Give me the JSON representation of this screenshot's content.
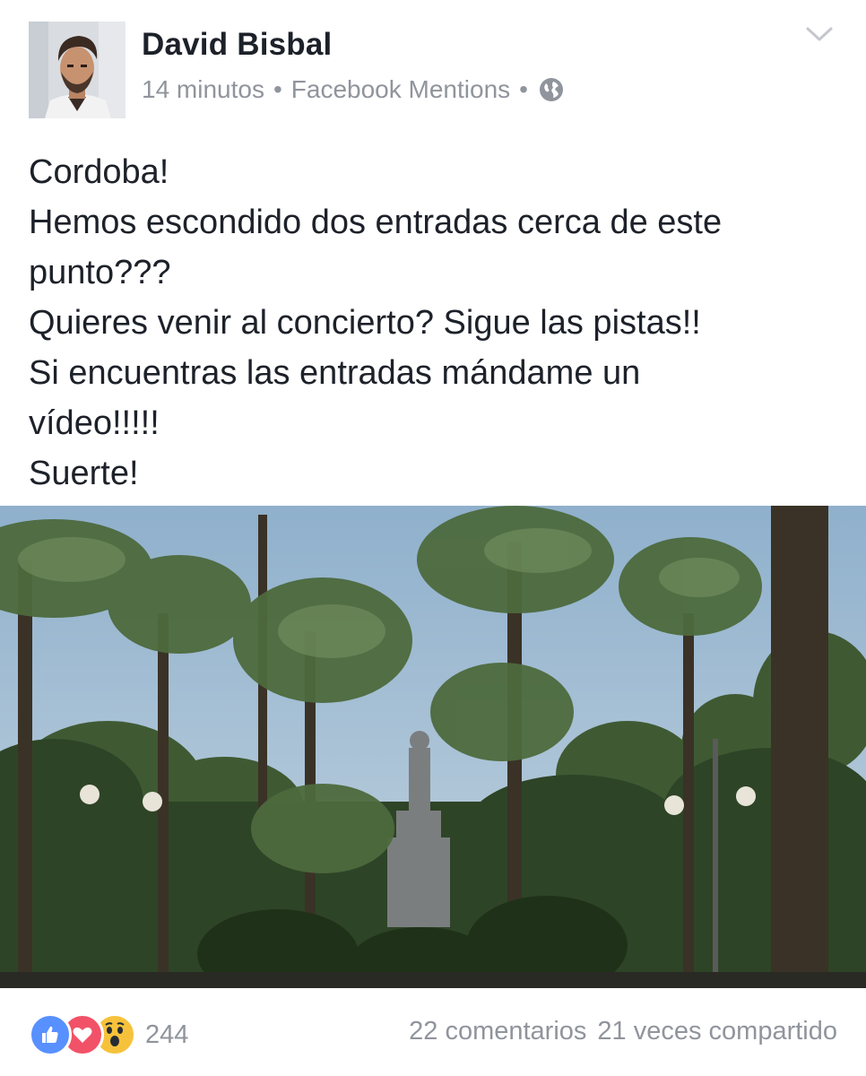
{
  "post": {
    "author": "David Bisbal",
    "time": "14 minutos",
    "separator": "•",
    "via": "Facebook Mentions",
    "privacy_icon": "globe-icon",
    "menu_icon": "chevron-down-icon",
    "text_lines": [
      "Cordoba!",
      "Hemos escondido dos entradas cerca de este",
      "punto???",
      "Quieres venir al concierto? Sigue las pistas!!",
      "Si encuentras las entradas mándame un",
      "vídeo!!!!!",
      "Suerte!"
    ]
  },
  "photo": {
    "subject": "palm-trees-park-statue"
  },
  "footer": {
    "reaction_icons": [
      "like-icon",
      "love-icon",
      "wow-icon"
    ],
    "reaction_count": "244",
    "comments": "22 comentarios",
    "shares": "21 veces compartido"
  },
  "colors": {
    "text": "#1d2129",
    "meta": "#90949c",
    "like": "#5890ff",
    "love": "#f25268",
    "wow": "#f7c23b",
    "sky": "#9fb8d0"
  }
}
